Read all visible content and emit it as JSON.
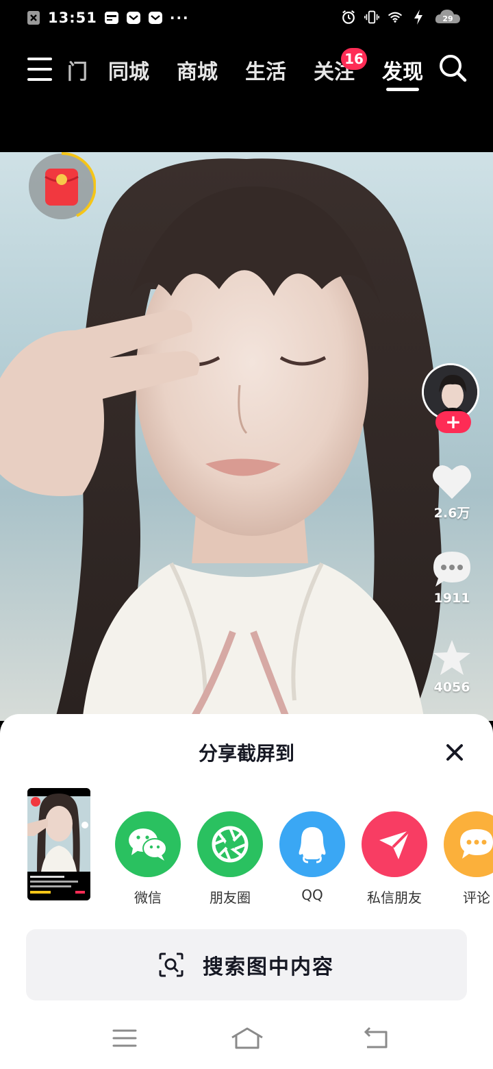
{
  "status_bar": {
    "time": "13:51",
    "more": "···",
    "battery": "29",
    "icons": [
      "close-box-icon",
      "card-icon",
      "message-icon",
      "message-icon",
      "alarm-icon",
      "vibrate-icon",
      "wifi-icon",
      "charging-icon",
      "battery-icon"
    ]
  },
  "top_nav": {
    "partial_tab": "门",
    "tabs": [
      {
        "label": "同城"
      },
      {
        "label": "商城"
      },
      {
        "label": "生活"
      },
      {
        "label": "关注",
        "badge": "16"
      },
      {
        "label": "发现",
        "active": true
      }
    ]
  },
  "video": {
    "likes": "2.6万",
    "comments": "1911",
    "favorites": "4056",
    "follow_plus": "+"
  },
  "share_sheet": {
    "title": "分享截屏到",
    "targets": [
      {
        "label": "微信",
        "color": "#2ac160",
        "icon": "wechat-icon"
      },
      {
        "label": "朋友圈",
        "color": "#2ac160",
        "icon": "moments-icon"
      },
      {
        "label": "QQ",
        "color": "#3aa7f4",
        "icon": "qq-icon"
      },
      {
        "label": "私信朋友",
        "color": "#f83d63",
        "icon": "send-icon"
      },
      {
        "label": "评论",
        "color": "#fbb03b",
        "icon": "comment-icon"
      }
    ],
    "search_label": "搜索图中内容"
  },
  "colors": {
    "accent": "#fe2c55",
    "sheet_bg": "#ffffff",
    "button_bg": "#f2f2f4"
  }
}
